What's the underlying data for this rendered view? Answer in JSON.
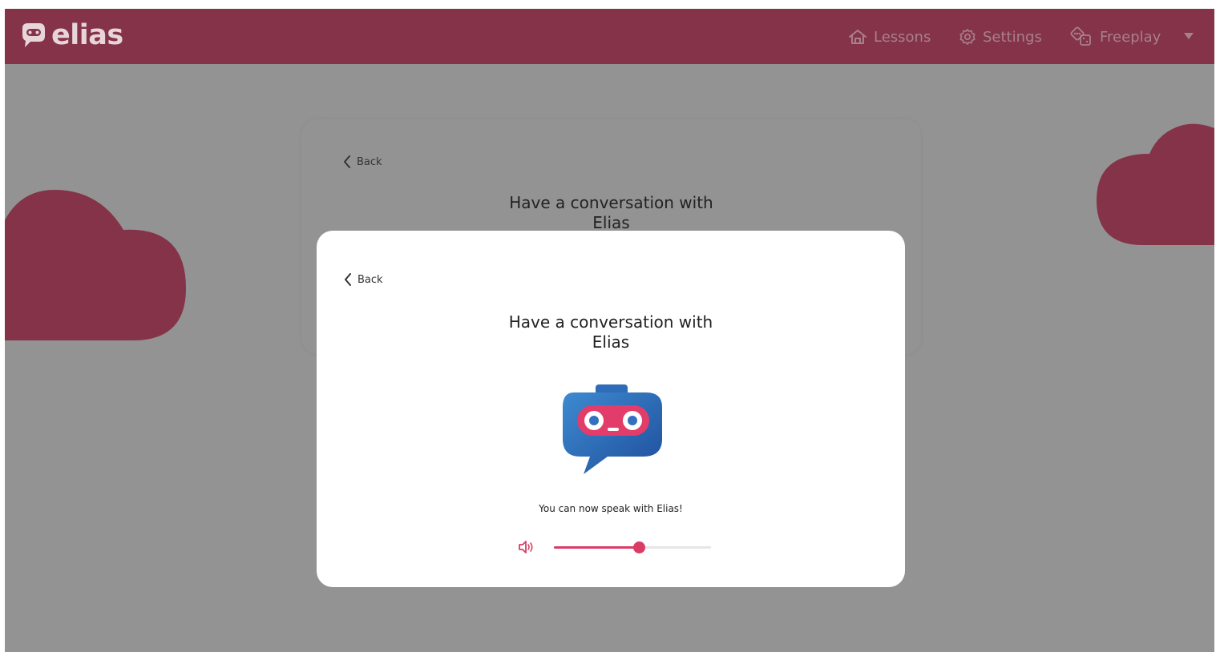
{
  "app": {
    "logo_text": "elias",
    "brand_color": "#843349",
    "accent_color": "#d93d66"
  },
  "nav": {
    "items": [
      {
        "label": "Lessons",
        "icon": "home-icon"
      },
      {
        "label": "Settings",
        "icon": "gear-icon"
      },
      {
        "label": "Freeplay",
        "icon": "dice-icon"
      }
    ],
    "dropdown_icon": "caret-down-icon"
  },
  "background_card": {
    "back_label": "Back",
    "title_line1": "Have a conversation with",
    "title_line2": "Elias"
  },
  "modal": {
    "back_label": "Back",
    "title_line1": "Have a conversation with",
    "title_line2": "Elias",
    "status_text": "You can now speak with Elias!",
    "volume_icon": "speaker-icon",
    "volume_level": 0.54
  }
}
